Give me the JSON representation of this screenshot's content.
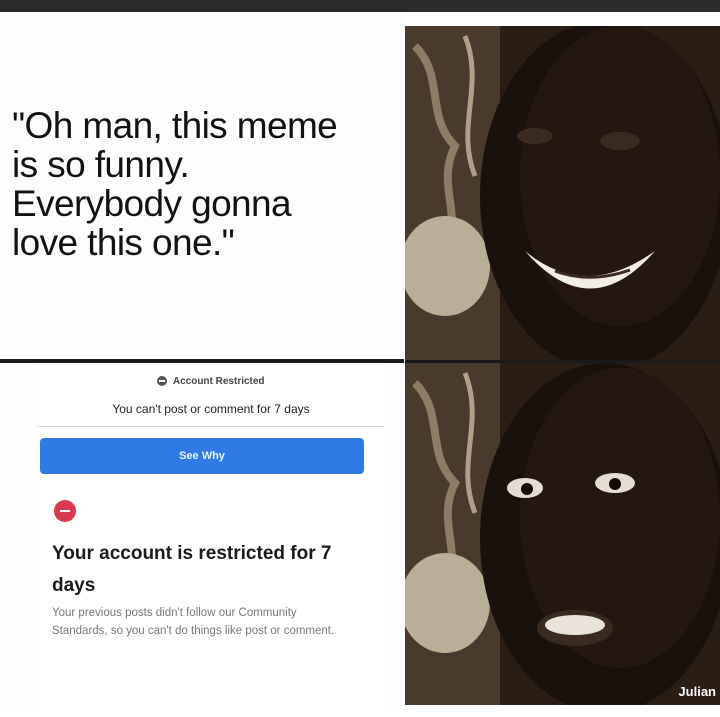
{
  "meme": {
    "quote": "\"Oh man, this meme\nis so funny.\nEverybody gonna\nlove this one.\""
  },
  "notice": {
    "header": "Account Restricted",
    "subtitle": "You can't post or comment for 7 days",
    "button_label": "See Why",
    "title": "Your account is restricted for 7 days",
    "body": "Your previous posts didn't follow our Community Standards, so you can't do things like post or comment."
  },
  "watermark": "Julian",
  "colors": {
    "button_blue": "#2f7ae5",
    "alert_red": "#d8394f"
  }
}
